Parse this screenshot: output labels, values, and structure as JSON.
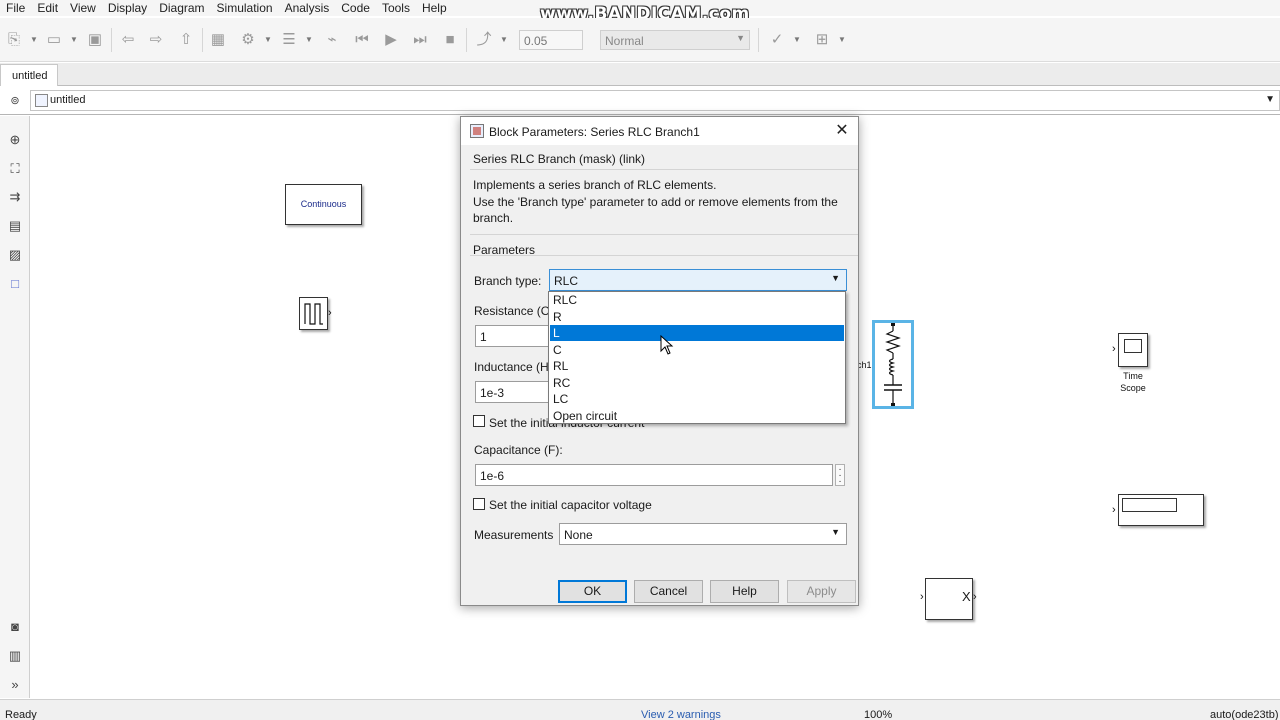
{
  "watermark": "www.BANDICAM.com",
  "menu": [
    "File",
    "Edit",
    "View",
    "Display",
    "Diagram",
    "Simulation",
    "Analysis",
    "Code",
    "Tools",
    "Help"
  ],
  "toolbar": {
    "stop_time": "0.05",
    "sim_mode": "Normal"
  },
  "tab": {
    "label": "untitled"
  },
  "address": {
    "path": "untitled"
  },
  "canvas": {
    "powergui_label": "Continuous",
    "rlc_label_fragment": "ch1",
    "scope_label_line1": "Time",
    "scope_label_line2": "Scope",
    "gain_label": "X"
  },
  "status": {
    "ready": "Ready",
    "warnings": "View 2 warnings",
    "zoom": "100%",
    "solver": "auto(ode23tb)"
  },
  "dialog": {
    "title": "Block Parameters: Series RLC Branch1",
    "subtitle": "Series RLC Branch (mask) (link)",
    "description_line1": "Implements a series branch of RLC elements.",
    "description_line2": "Use the 'Branch type' parameter to add or remove elements from the",
    "description_line3": "branch.",
    "parameters_heading": "Parameters",
    "branch_type_label": "Branch type:",
    "branch_type_value": "RLC",
    "resistance_label": "Resistance (O",
    "resistance_value": "1",
    "inductance_label": "Inductance (H",
    "inductance_value": "1e-3",
    "init_inductor_label": "Set the initial inductor current",
    "capacitance_label": "Capacitance (F):",
    "capacitance_value": "1e-6",
    "init_capacitor_label": "Set the initial capacitor voltage",
    "measurements_label": "Measurements",
    "measurements_value": "None",
    "buttons": {
      "ok": "OK",
      "cancel": "Cancel",
      "help": "Help",
      "apply": "Apply"
    }
  },
  "branch_type_options": [
    "RLC",
    "R",
    "L",
    "C",
    "RL",
    "RC",
    "LC",
    "Open circuit"
  ],
  "branch_type_highlighted": "L",
  "colors": {
    "selection": "#0078d7",
    "rlc_selection": "#5ab4e6",
    "link": "#2a5db0"
  }
}
